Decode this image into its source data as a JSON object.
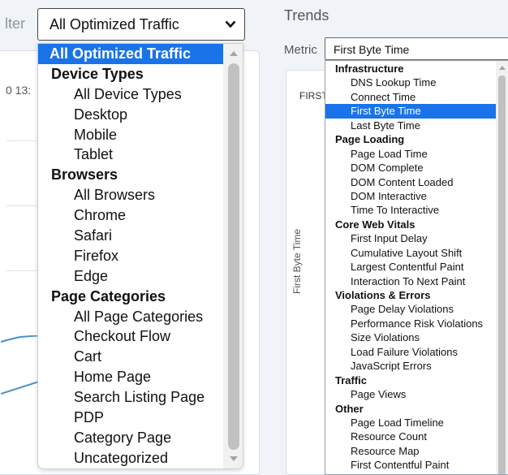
{
  "left": {
    "filter_label": "lter",
    "select_value": "All Optimized Traffic",
    "chart_tick": "0 13:",
    "dropdown": {
      "items": [
        {
          "label": "All Optimized Traffic",
          "kind": "top",
          "selected": true
        },
        {
          "label": "Device Types",
          "kind": "group"
        },
        {
          "label": "All Device Types",
          "kind": "opt"
        },
        {
          "label": "Desktop",
          "kind": "opt"
        },
        {
          "label": "Mobile",
          "kind": "opt"
        },
        {
          "label": "Tablet",
          "kind": "opt"
        },
        {
          "label": "Browsers",
          "kind": "group"
        },
        {
          "label": "All Browsers",
          "kind": "opt"
        },
        {
          "label": "Chrome",
          "kind": "opt"
        },
        {
          "label": "Safari",
          "kind": "opt"
        },
        {
          "label": "Firefox",
          "kind": "opt"
        },
        {
          "label": "Edge",
          "kind": "opt"
        },
        {
          "label": "Page Categories",
          "kind": "group"
        },
        {
          "label": "All Page Categories",
          "kind": "opt"
        },
        {
          "label": "Checkout Flow",
          "kind": "opt"
        },
        {
          "label": "Cart",
          "kind": "opt"
        },
        {
          "label": "Home Page",
          "kind": "opt"
        },
        {
          "label": "Search Listing Page",
          "kind": "opt"
        },
        {
          "label": "PDP",
          "kind": "opt"
        },
        {
          "label": "Category Page",
          "kind": "opt"
        },
        {
          "label": "Uncategorized",
          "kind": "opt"
        }
      ]
    }
  },
  "right": {
    "title": "Trends",
    "metric_label": "Metric",
    "select_value": "First Byte Time",
    "chart_title": "FIRST",
    "y_axis_label": "First Byte Time",
    "dropdown": {
      "items": [
        {
          "label": "Infrastructure",
          "kind": "group"
        },
        {
          "label": "DNS Lookup Time",
          "kind": "opt"
        },
        {
          "label": "Connect Time",
          "kind": "opt"
        },
        {
          "label": "First Byte Time",
          "kind": "opt",
          "selected": true
        },
        {
          "label": "Last Byte Time",
          "kind": "opt"
        },
        {
          "label": "Page Loading",
          "kind": "group"
        },
        {
          "label": "Page Load Time",
          "kind": "opt"
        },
        {
          "label": "DOM Complete",
          "kind": "opt"
        },
        {
          "label": "DOM Content Loaded",
          "kind": "opt"
        },
        {
          "label": "DOM Interactive",
          "kind": "opt"
        },
        {
          "label": "Time To Interactive",
          "kind": "opt"
        },
        {
          "label": "Core Web Vitals",
          "kind": "group"
        },
        {
          "label": "First Input Delay",
          "kind": "opt"
        },
        {
          "label": "Cumulative Layout Shift",
          "kind": "opt"
        },
        {
          "label": "Largest Contentful Paint",
          "kind": "opt"
        },
        {
          "label": "Interaction To Next Paint",
          "kind": "opt"
        },
        {
          "label": "Violations & Errors",
          "kind": "group"
        },
        {
          "label": "Page Delay Violations",
          "kind": "opt"
        },
        {
          "label": "Performance Risk Violations",
          "kind": "opt"
        },
        {
          "label": "Size Violations",
          "kind": "opt"
        },
        {
          "label": "Load Failure Violations",
          "kind": "opt"
        },
        {
          "label": "JavaScript Errors",
          "kind": "opt"
        },
        {
          "label": "Traffic",
          "kind": "group"
        },
        {
          "label": "Page Views",
          "kind": "opt"
        },
        {
          "label": "Other",
          "kind": "group"
        },
        {
          "label": "Page Load Timeline",
          "kind": "opt"
        },
        {
          "label": "Resource Count",
          "kind": "opt"
        },
        {
          "label": "Resource Map",
          "kind": "opt"
        },
        {
          "label": "First Contentful Paint",
          "kind": "opt"
        }
      ]
    }
  },
  "colors": {
    "selection": "#1a73e8",
    "chart_line": "#4a90c8"
  }
}
